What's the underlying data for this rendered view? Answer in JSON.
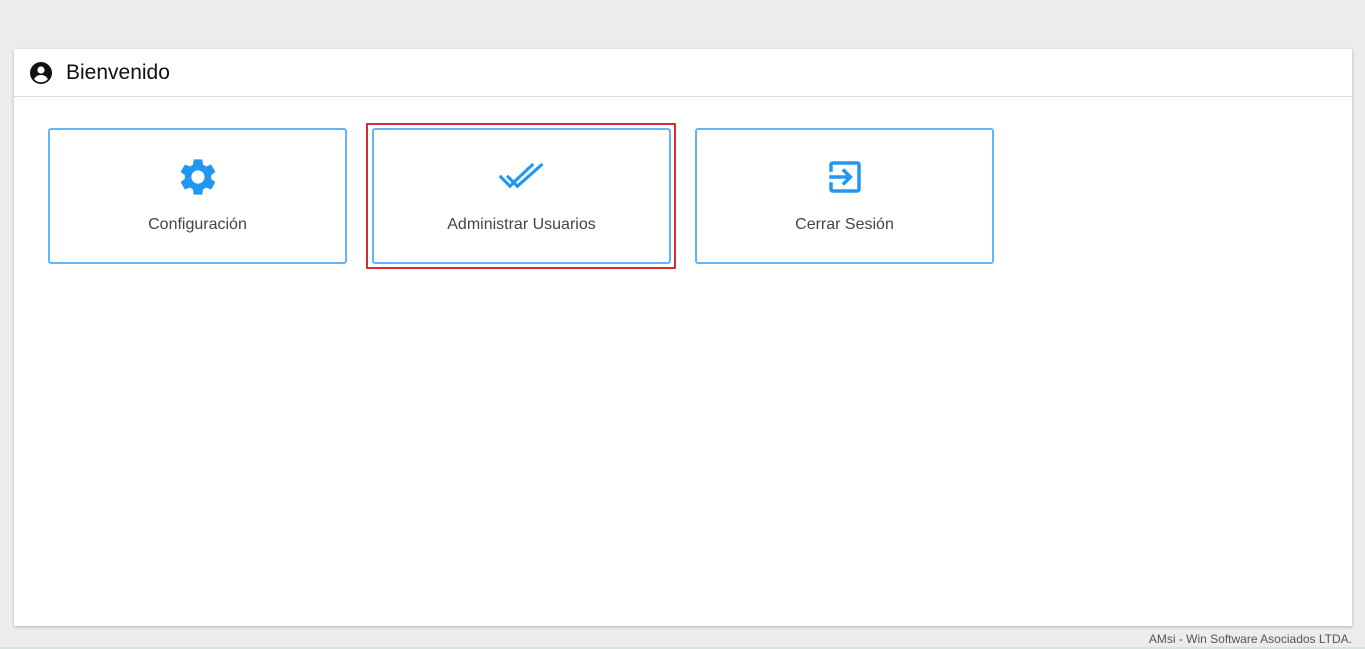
{
  "header": {
    "title": "Bienvenido",
    "icon": "account-circle-icon"
  },
  "tiles": [
    {
      "label": "Configuración",
      "icon": "gear-icon"
    },
    {
      "label": "Administrar Usuarios",
      "icon": "double-check-icon"
    },
    {
      "label": "Cerrar Sesión",
      "icon": "logout-icon"
    }
  ],
  "footer": {
    "text": "AMsi - Win Software Asociados LTDA."
  },
  "colors": {
    "accent": "#2196f3",
    "tile_border": "#64b5f6",
    "highlight": "#d32f2f"
  }
}
